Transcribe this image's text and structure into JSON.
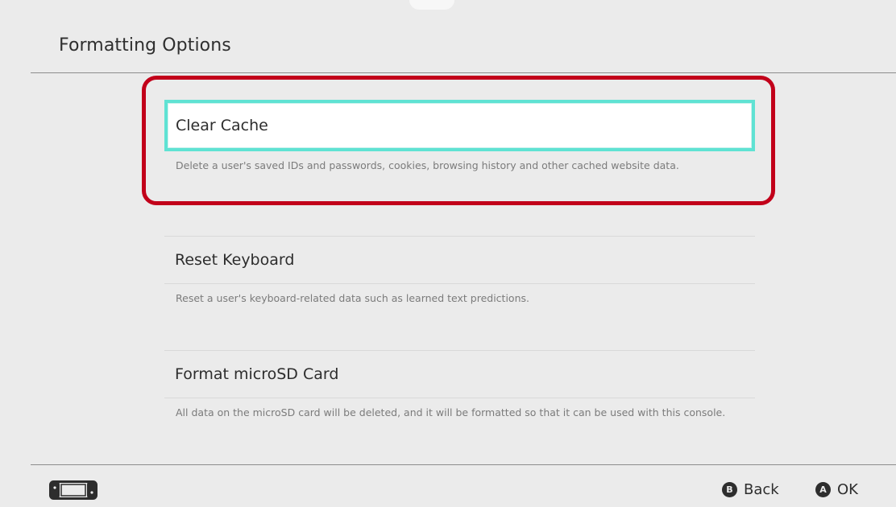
{
  "header": {
    "title": "Formatting Options"
  },
  "options": [
    {
      "label": "Clear Cache",
      "description": "Delete a user's saved IDs and passwords, cookies, browsing history and other cached website data.",
      "selected": true
    },
    {
      "label": "Reset Keyboard",
      "description": "Reset a user's keyboard-related data such as learned text predictions.",
      "selected": false
    },
    {
      "label": "Format microSD Card",
      "description": "All data on the microSD card will be deleted, and it will be formatted so that it can be used with this console.",
      "selected": false
    }
  ],
  "footer": {
    "console_icon": "handheld-console-icon",
    "back": {
      "glyph": "B",
      "label": "Back"
    },
    "ok": {
      "glyph": "A",
      "label": "OK"
    }
  },
  "colors": {
    "background": "#ebebeb",
    "selection_outline": "#5fe2d3",
    "annotation_frame": "#c2001a",
    "text_primary": "#2d2d2d",
    "text_secondary": "#7b7b7b"
  }
}
